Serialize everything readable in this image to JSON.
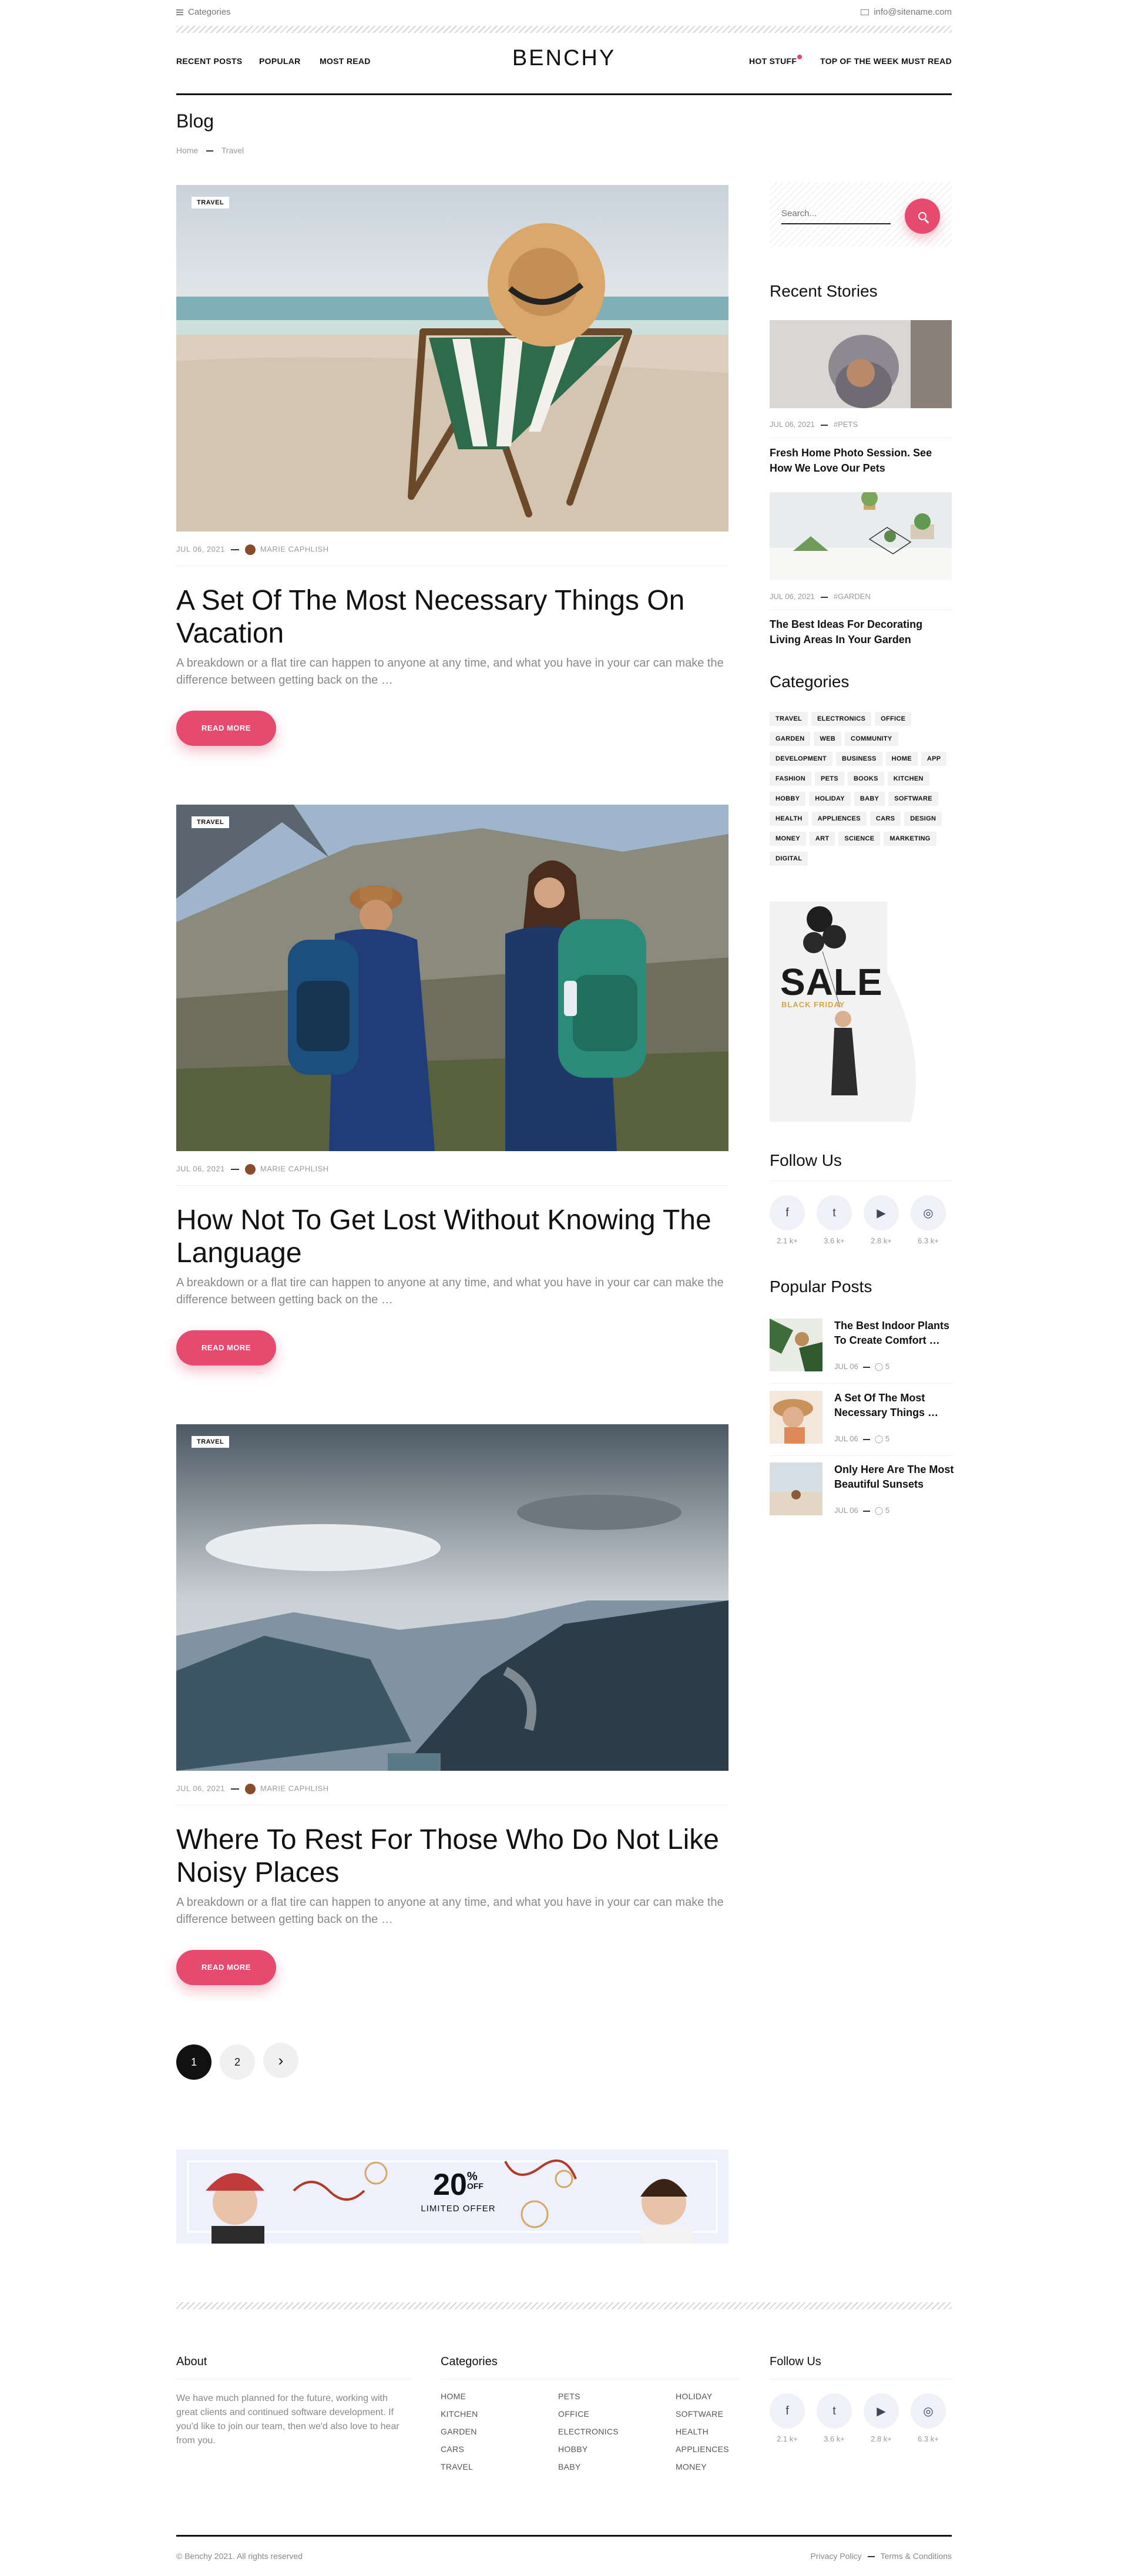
{
  "topbar": {
    "categories_label": "Categories",
    "email": "info@sitename.com"
  },
  "nav": {
    "left": [
      "RECENT POSTS",
      "POPULAR",
      "MOST READ"
    ],
    "logo": "BENCHY",
    "right": [
      "HOT STUFF",
      "TOP OF THE WEEK",
      "MUST READ"
    ]
  },
  "page": {
    "title": "Blog",
    "crumb_home": "Home",
    "crumb_current": "Travel"
  },
  "posts": [
    {
      "tag": "TRAVEL",
      "date": "JUL 06, 2021",
      "author": "MARIE CAPHLISH",
      "title": "A Set Of The Most Necessary Things On Vacation",
      "excerpt": "A breakdown or a flat tire can happen to anyone at any time, and what you have in your car can make the difference between getting back on the …",
      "button": "READ MORE"
    },
    {
      "tag": "TRAVEL",
      "date": "JUL 06, 2021",
      "author": "MARIE CAPHLISH",
      "title": "How Not To Get Lost Without Knowing The Language",
      "excerpt": "A breakdown or a flat tire can happen to anyone at any time, and what you have in your car can make the difference between getting back on the …",
      "button": "READ MORE"
    },
    {
      "tag": "TRAVEL",
      "date": "JUL 06, 2021",
      "author": "MARIE CAPHLISH",
      "title": "Where To Rest For Those Who Do Not Like Noisy Places",
      "excerpt": "A breakdown or a flat tire can happen to anyone at any time, and what you have in your car can make the difference between getting back on the …",
      "button": "READ MORE"
    }
  ],
  "pagination": {
    "pages": [
      "1",
      "2"
    ],
    "next": "›"
  },
  "banner": {
    "percent": "20",
    "pct_sign": "%",
    "off": "OFF",
    "sub": "LIMITED OFFER"
  },
  "sidebar": {
    "search_placeholder": "Search...",
    "recent_title": "Recent Stories",
    "recent": [
      {
        "date": "JUL 06, 2021",
        "tag": "#PETS",
        "title": "Fresh Home Photo Session. See How We Love Our Pets"
      },
      {
        "date": "JUL 06, 2021",
        "tag": "#GARDEN",
        "title": "The Best Ideas For Decorating Living Areas In Your Garden"
      }
    ],
    "categories_title": "Categories",
    "categories": [
      "TRAVEL",
      "ELECTRONICS",
      "OFFICE",
      "GARDEN",
      "WEB",
      "COMMUNITY",
      "DEVELOPMENT",
      "BUSINESS",
      "HOME",
      "APP",
      "FASHION",
      "PETS",
      "BOOKS",
      "KITCHEN",
      "HOBBY",
      "HOLIDAY",
      "BABY",
      "SOFTWARE",
      "HEALTH",
      "APPLIENCES",
      "CARS",
      "DESIGN",
      "MONEY",
      "ART",
      "SCIENCE",
      "MARKETING",
      "DIGITAL"
    ],
    "ad": {
      "sale": "SALE",
      "sub": "BLACK FRIDAY"
    },
    "follow_title": "Follow Us",
    "social": [
      {
        "icon": "facebook-icon",
        "glyph": "f",
        "count": "2.1 k+"
      },
      {
        "icon": "twitter-icon",
        "glyph": "t",
        "count": "3.6 k+"
      },
      {
        "icon": "youtube-icon",
        "glyph": "▶",
        "count": "2.8 k+"
      },
      {
        "icon": "instagram-icon",
        "glyph": "◎",
        "count": "6.3 k+"
      }
    ],
    "popular_title": "Popular Posts",
    "popular": [
      {
        "title": "The Best Indoor Plants To Create Comfort …",
        "date": "JUL 06",
        "comments": "5"
      },
      {
        "title": "A Set Of The Most Necessary Things …",
        "date": "JUL 06",
        "comments": "5"
      },
      {
        "title": "Only Here Are The Most Beautiful Sunsets",
        "date": "JUL 06",
        "comments": "5"
      }
    ]
  },
  "footer": {
    "about_title": "About",
    "about_text": "We have much planned for the future, working with great clients and continued software development. If you'd like to join our team, then we'd also love to hear from you.",
    "categories_title": "Categories",
    "cat_cols": [
      [
        "HOME",
        "KITCHEN",
        "GARDEN",
        "CARS",
        "TRAVEL"
      ],
      [
        "PETS",
        "OFFICE",
        "ELECTRONICS",
        "HOBBY",
        "BABY"
      ],
      [
        "HOLIDAY",
        "SOFTWARE",
        "HEALTH",
        "APPLIENCES",
        "MONEY"
      ]
    ],
    "follow_title": "Follow Us",
    "copyright": "© Benchy 2021. All rights reserved",
    "privacy": "Privacy Policy",
    "terms": "Terms & Conditions"
  },
  "colors": {
    "accent": "#e64a6e",
    "text": "#111111",
    "muted": "#999999"
  }
}
